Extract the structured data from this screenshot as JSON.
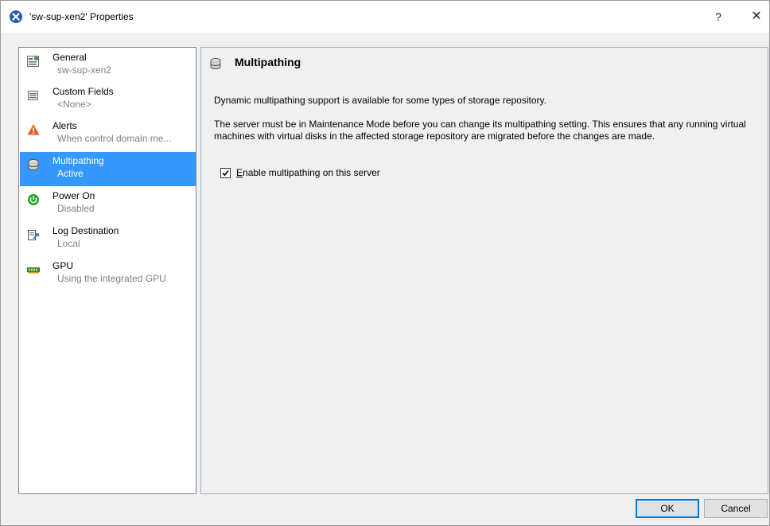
{
  "window": {
    "title": "'sw-sup-xen2' Properties",
    "help_label": "?",
    "close_label": "✕"
  },
  "sidebar": {
    "items": [
      {
        "title": "General",
        "subtitle": "sw-sup-xen2",
        "icon": "general-icon",
        "selected": false
      },
      {
        "title": "Custom Fields",
        "subtitle": "<None>",
        "icon": "custom-fields-icon",
        "selected": false
      },
      {
        "title": "Alerts",
        "subtitle": "When control domain me...",
        "icon": "warning-icon",
        "selected": false
      },
      {
        "title": "Multipathing",
        "subtitle": "Active",
        "icon": "storage-icon",
        "selected": true
      },
      {
        "title": "Power On",
        "subtitle": "Disabled",
        "icon": "power-icon",
        "selected": false
      },
      {
        "title": "Log Destination",
        "subtitle": "Local",
        "icon": "log-destination-icon",
        "selected": false
      },
      {
        "title": "GPU",
        "subtitle": "Using the integrated GPU",
        "icon": "gpu-icon",
        "selected": false
      }
    ]
  },
  "content": {
    "heading": "Multipathing",
    "paragraph1": "Dynamic multipathing support is available for some types of storage repository.",
    "paragraph2": "The server must be in Maintenance Mode before you can change its multipathing setting. This ensures that any running virtual machines with virtual disks in the affected storage repository are migrated before the changes are made.",
    "checkbox": {
      "accel": "E",
      "label_rest": "nable multipathing on this server",
      "checked": true
    }
  },
  "buttons": {
    "ok": "OK",
    "cancel": "Cancel"
  },
  "colors": {
    "selection": "#3399ff",
    "alert": "#e8621a",
    "power": "#2aa52a",
    "gpu": "#3a7d2a"
  }
}
